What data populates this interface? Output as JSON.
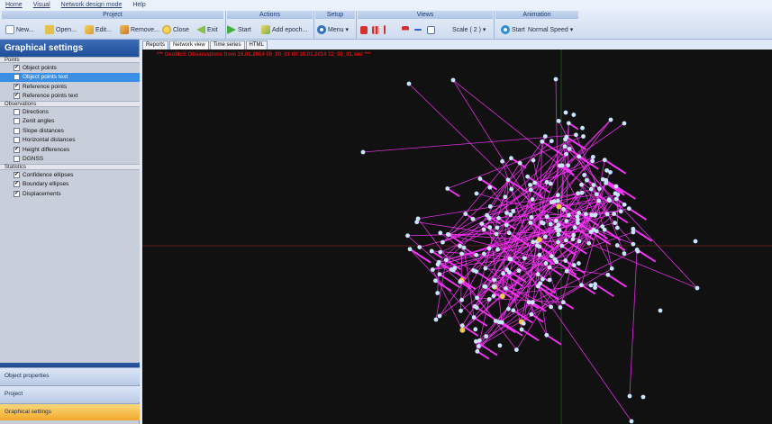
{
  "menu": {
    "items": [
      "Home",
      "Visual",
      "Network design mode",
      "Help"
    ]
  },
  "ribbon": {
    "groups": {
      "project": "Project",
      "actions": "Actions",
      "setup": "Setup",
      "views": "Views",
      "animation": "Animation"
    },
    "buttons": {
      "new": "New...",
      "open": "Open...",
      "edit": "Edit...",
      "remove": "Remove...",
      "close": "Close",
      "exit": "Exit",
      "start": "Start",
      "add_epoch": "Add epoch...",
      "menu": "Menu",
      "scale": "Scale ( 2 )",
      "anim_start": "Start",
      "speed": "Normal Speed"
    }
  },
  "left_panel": {
    "title": "Graphical settings",
    "categories": {
      "points": "Points",
      "observations": "Observations",
      "statistics": "Statistics"
    },
    "points": [
      {
        "label": "Object points",
        "checked": true
      },
      {
        "label": "Object points text",
        "checked": false,
        "selected": true
      },
      {
        "label": "Reference points",
        "checked": true
      },
      {
        "label": "Reference points text",
        "checked": true
      }
    ],
    "observations": [
      {
        "label": "Directions",
        "checked": false
      },
      {
        "label": "Zenit angles",
        "checked": false
      },
      {
        "label": "Slope distances",
        "checked": false
      },
      {
        "label": "Horizontal distances",
        "checked": false
      },
      {
        "label": "Height differences",
        "checked": true
      },
      {
        "label": "DGNSS",
        "checked": false
      }
    ],
    "statistics": [
      {
        "label": "Confidence ellipses",
        "checked": true
      },
      {
        "label": "Boundary ellipses",
        "checked": true
      },
      {
        "label": "Displacements",
        "checked": true
      }
    ],
    "nav": {
      "object_properties": "Object properties",
      "project": "Project",
      "graphical_settings": "Graphical settings"
    }
  },
  "view": {
    "tabs": [
      "Reports",
      "Network view",
      "Time series",
      "HTML"
    ],
    "active_tab": "Network view",
    "title": "*** GeoMoS Observations from 16.01.2014 06_00_01 till 16.01.2014 12_00_01.xml ***",
    "colors": {
      "background": "#111111",
      "lines": "#ff33ff",
      "object_points": "#c9e6ff",
      "reference_points": "#f2c94c",
      "axes": "#6b1f1f"
    }
  }
}
